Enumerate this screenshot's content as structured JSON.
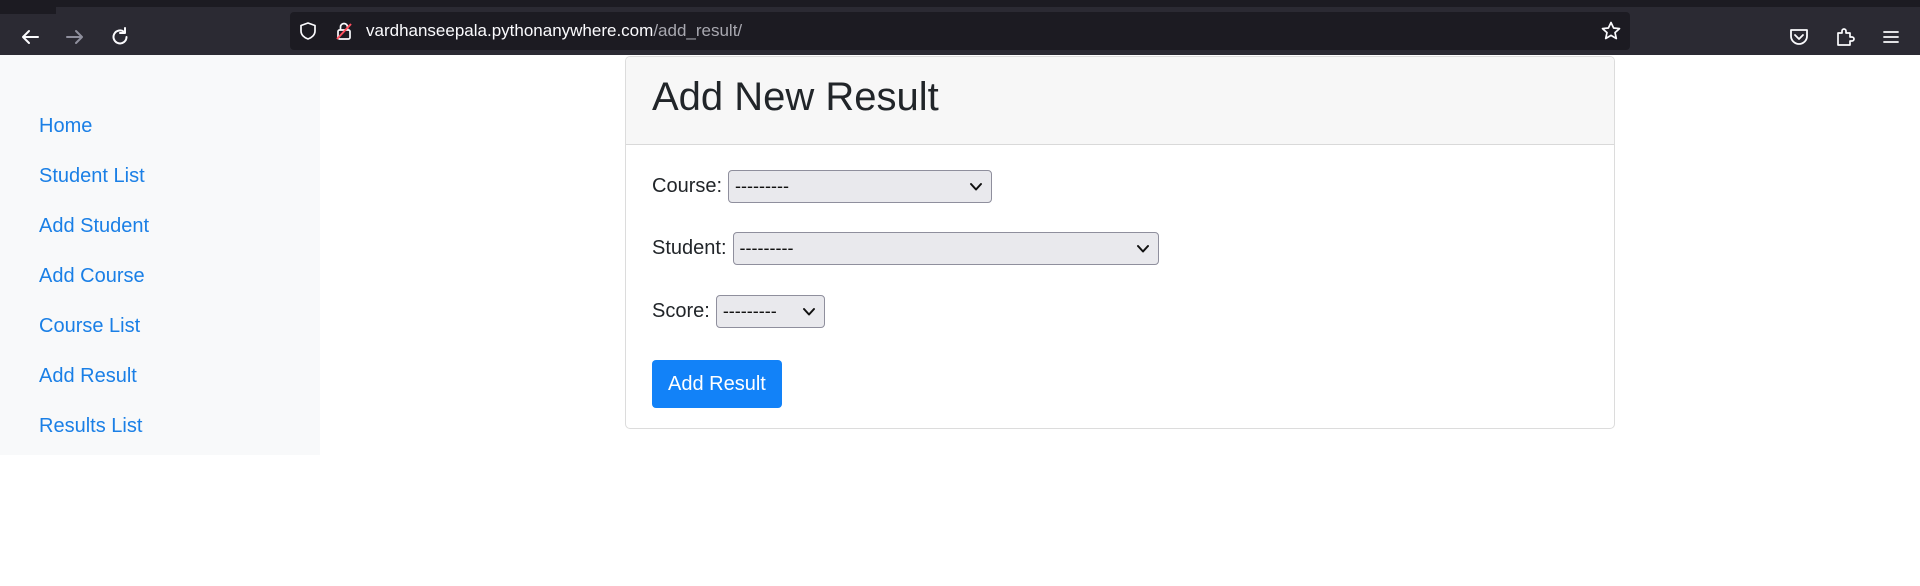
{
  "browser": {
    "url_host": "vardhanseepala.pythonanywhere.com",
    "url_path": "/add_result/",
    "icons": {
      "back": "back-arrow-icon",
      "forward": "forward-arrow-icon",
      "reload": "reload-icon",
      "shield": "shield-icon",
      "lock": "insecure-lock-icon",
      "bookmark": "star-icon",
      "pocket": "pocket-icon",
      "extensions": "puzzle-icon",
      "menu": "hamburger-menu-icon"
    }
  },
  "sidebar": {
    "items": [
      {
        "label": "Home"
      },
      {
        "label": "Student List"
      },
      {
        "label": "Add Student"
      },
      {
        "label": "Add Course"
      },
      {
        "label": "Course List"
      },
      {
        "label": "Add Result"
      },
      {
        "label": "Results List"
      }
    ]
  },
  "form": {
    "title": "Add New Result",
    "course": {
      "label": "Course:",
      "value": "---------"
    },
    "student": {
      "label": "Student:",
      "value": "---------"
    },
    "score": {
      "label": "Score:",
      "value": "---------"
    },
    "submit_label": "Add Result"
  },
  "colors": {
    "link": "#1a7fe6",
    "primary_button": "#1282f8",
    "sidebar_bg": "#f8f9fa",
    "toolbar_bg": "#2b2a33"
  }
}
